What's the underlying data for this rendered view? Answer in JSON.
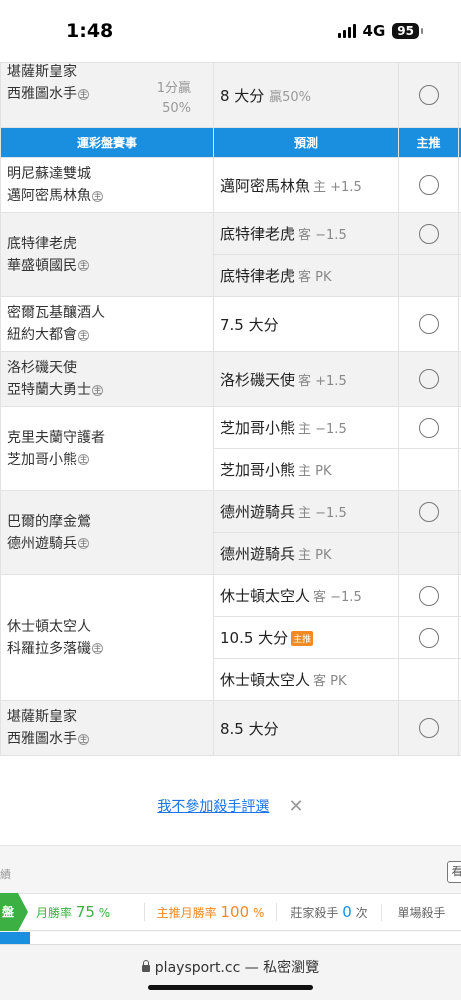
{
  "status_bar": {
    "time": "1:48",
    "network": "4G",
    "battery": "95"
  },
  "home_mark": "主",
  "top_row": {
    "team1": "堪薩斯皇家",
    "team2": "西雅圖水手",
    "result_line1": "1分贏",
    "result_line2": "50%",
    "prediction": "8 大分",
    "prediction_note": "贏50%"
  },
  "table_header": {
    "col_game": "運彩盤賽事",
    "col_prediction": "預測",
    "col_main": "主推"
  },
  "games": [
    {
      "team1": "明尼蘇達雙城",
      "team2": "邁阿密馬林魚",
      "options": [
        {
          "pick": "邁阿密馬林魚",
          "detail": "主 +1.5",
          "badge": ""
        }
      ]
    },
    {
      "team1": "底特律老虎",
      "team2": "華盛頓國民",
      "options": [
        {
          "pick": "底特律老虎",
          "detail": "客 −1.5",
          "badge": ""
        },
        {
          "pick": "底特律老虎",
          "detail": "客 PK",
          "badge": ""
        }
      ]
    },
    {
      "team1": "密爾瓦基釀酒人",
      "team2": "紐約大都會",
      "options": [
        {
          "pick": "7.5 大分",
          "detail": "",
          "badge": ""
        }
      ]
    },
    {
      "team1": "洛杉磯天使",
      "team2": "亞特蘭大勇士",
      "options": [
        {
          "pick": "洛杉磯天使",
          "detail": "客 +1.5",
          "badge": ""
        }
      ]
    },
    {
      "team1": "克里夫蘭守護者",
      "team2": "芝加哥小熊",
      "options": [
        {
          "pick": "芝加哥小熊",
          "detail": "主 −1.5",
          "badge": ""
        },
        {
          "pick": "芝加哥小熊",
          "detail": "主 PK",
          "badge": ""
        }
      ]
    },
    {
      "team1": "巴爾的摩金鶯",
      "team2": "德州遊騎兵",
      "options": [
        {
          "pick": "德州遊騎兵",
          "detail": "主 −1.5",
          "badge": ""
        },
        {
          "pick": "德州遊騎兵",
          "detail": "主 PK",
          "badge": ""
        }
      ]
    },
    {
      "team1": "休士頓太空人",
      "team2": "科羅拉多落磯",
      "options": [
        {
          "pick": "休士頓太空人",
          "detail": "客 −1.5",
          "badge": ""
        },
        {
          "pick": "10.5 大分",
          "detail": "",
          "badge": "主推"
        },
        {
          "pick": "休士頓太空人",
          "detail": "客 PK",
          "badge": ""
        }
      ]
    },
    {
      "team1": "堪薩斯皇家",
      "team2": "西雅圖水手",
      "options": [
        {
          "pick": "8.5 大分",
          "detail": "",
          "badge": ""
        }
      ]
    }
  ],
  "opt_out": {
    "link": "我不參加殺手評選",
    "close": "✕"
  },
  "stats": {
    "left_label": "績",
    "right_button": "看",
    "tag": "盤",
    "monthly_rate_label": "月勝率",
    "monthly_rate_value": "75",
    "monthly_rate_unit": "%",
    "main_rate_label": "主推月勝率",
    "main_rate_value": "100",
    "main_rate_unit": "%",
    "killer_label": "莊家殺手",
    "killer_value": "0",
    "killer_unit": "次",
    "single_label": "單場殺手"
  },
  "browser": {
    "domain": "playsport.cc",
    "mode": "— 私密瀏覽"
  }
}
